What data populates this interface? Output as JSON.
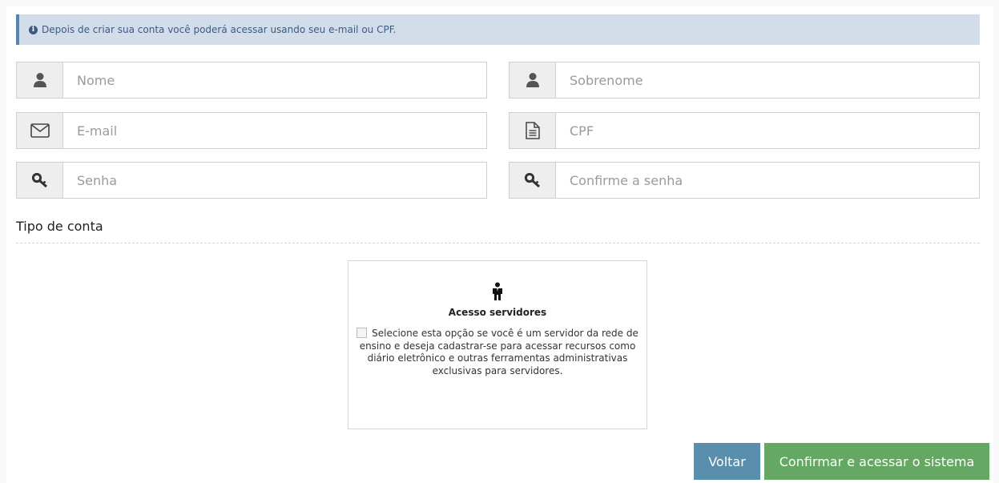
{
  "info": {
    "icon": "info-icon",
    "text": "Depois de criar sua conta você poderá acessar usando seu e-mail ou CPF."
  },
  "form": {
    "nome": {
      "placeholder": "Nome",
      "icon": "user-icon"
    },
    "sobrenome": {
      "placeholder": "Sobrenome",
      "icon": "user-icon"
    },
    "email": {
      "placeholder": "E-mail",
      "icon": "envelope-icon"
    },
    "cpf": {
      "placeholder": "CPF",
      "icon": "document-icon"
    },
    "senha": {
      "placeholder": "Senha",
      "icon": "key-icon"
    },
    "confirme": {
      "placeholder": "Confirme a senha",
      "icon": "key-icon"
    }
  },
  "account_type": {
    "title": "Tipo de conta",
    "card": {
      "icon": "person-icon",
      "title": "Acesso servidores",
      "checked": false,
      "description": "Selecione esta opção se você é um servidor da rede de ensino e deseja cadastrar-se para acessar recursos como diário eletrônico e outras ferramentas administrativas exclusivas para servidores."
    }
  },
  "buttons": {
    "back": "Voltar",
    "confirm": "Confirmar e acessar o sistema"
  },
  "colors": {
    "info_bg": "#d3dde9",
    "info_accent": "#5585b5",
    "back_button": "#5a8ead",
    "confirm_button": "#65a863"
  }
}
